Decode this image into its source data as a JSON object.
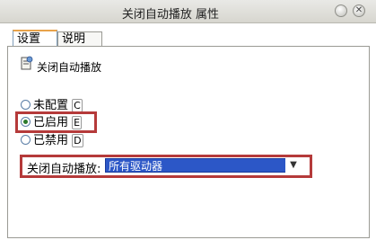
{
  "window": {
    "title": "关闭自动播放 属性"
  },
  "tabs": [
    {
      "label": "设置",
      "active": true
    },
    {
      "label": "说明",
      "active": false
    }
  ],
  "policy": {
    "title": "关闭自动播放",
    "icon": "policy-settings-icon"
  },
  "options": [
    {
      "label": "未配置",
      "hotkey": "C",
      "checked": false
    },
    {
      "label": "已启用",
      "hotkey": "E",
      "checked": true
    },
    {
      "label": "已禁用",
      "hotkey": "D",
      "checked": false
    }
  ],
  "setting": {
    "label": "关闭自动播放:",
    "value": "所有驱动器"
  },
  "colors": {
    "highlight": "#b53a3a",
    "selection": "#2c57c7"
  }
}
